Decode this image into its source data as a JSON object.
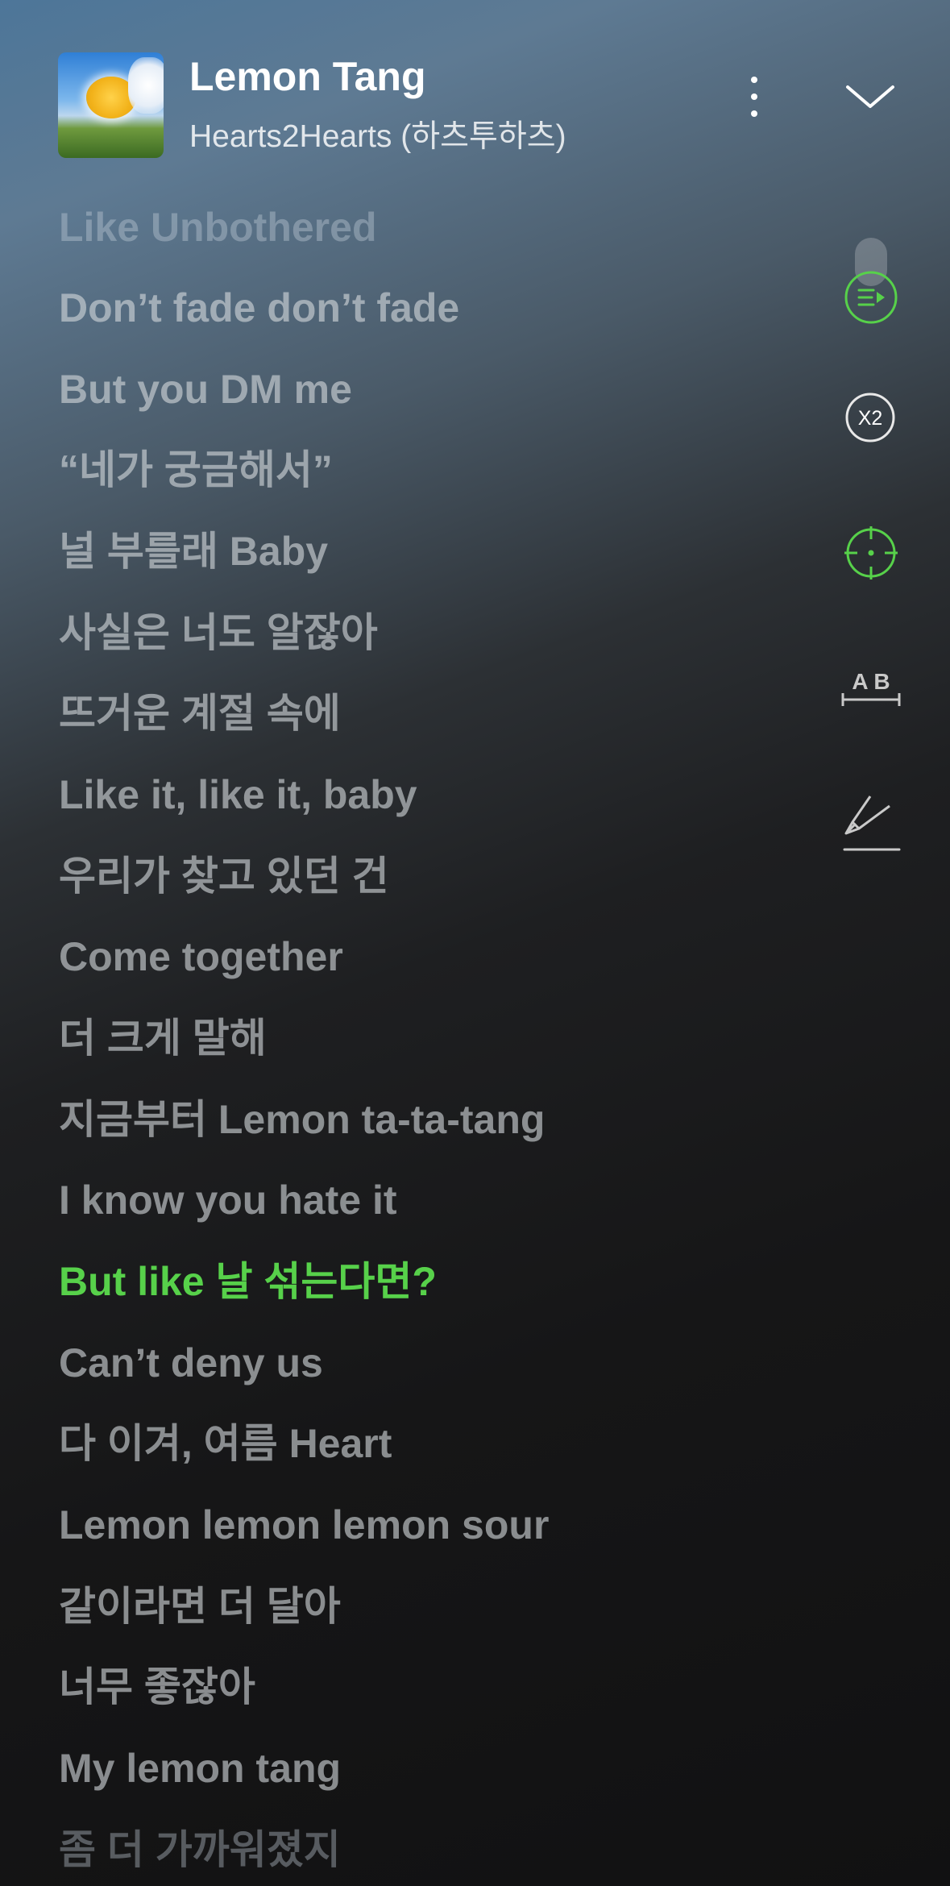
{
  "player": {
    "track_title": "Lemon Tang",
    "artist": "Hearts2Hearts (하츠투하츠)",
    "accent_color": "#57d14a"
  },
  "icons": {
    "more": "more-vertical-icon",
    "collapse": "chevron-down-icon",
    "autoscroll": "auto-scroll-play-icon",
    "speed": "speed-x2-icon",
    "focus": "crosshair-focus-icon",
    "font_size": "text-size-ab-icon",
    "highlight": "highlighter-pen-icon"
  },
  "tools": {
    "speed_label": "X2",
    "font_size_label": "A B"
  },
  "lyrics": {
    "active_index": 13,
    "lines": [
      "Like Unbothered",
      "Don’t fade don’t fade",
      "But you DM me",
      "“네가 궁금해서”",
      "널 부를래 Baby",
      "사실은 너도 알잖아",
      "뜨거운 계절 속에",
      "Like it, like it, baby",
      "우리가 찾고 있던 건",
      "Come together",
      "더 크게 말해",
      "지금부터 Lemon ta-ta-tang",
      "I know you hate it",
      "But like 날 섞는다면?",
      "Can’t deny us",
      "다 이겨, 여름 Heart",
      "Lemon lemon lemon sour",
      "같이라면 더 달아",
      "너무 좋잖아",
      "My lemon tang",
      "좀 더 가까워졌지"
    ]
  }
}
